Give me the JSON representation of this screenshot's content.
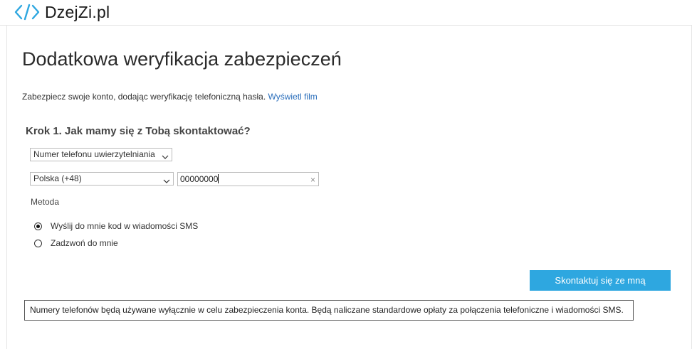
{
  "header": {
    "logo_text": "DzejZi.pl",
    "logo_icon": "code-brackets-icon",
    "accent_color": "#2ea7e0"
  },
  "main": {
    "title": "Dodatkowa weryfikacja zabezpieczeń",
    "intro_text": "Zabezpiecz swoje konto, dodając weryfikację telefoniczną hasła.",
    "intro_link": "Wyświetl film",
    "step_title": "Krok 1. Jak mamy się z Tobą skontaktować?",
    "auth_method_select": {
      "value": "Numer telefonu uwierzytelniania"
    },
    "country_select": {
      "value": "Polska (+48)"
    },
    "phone_input": {
      "value": "00000000"
    },
    "method_label": "Metoda",
    "radio_options": [
      {
        "label": "Wyślij do mnie kod w wiadomości SMS",
        "checked": true
      },
      {
        "label": "Zadzwoń do mnie",
        "checked": false
      }
    ],
    "contact_button": "Skontaktuj się ze mną",
    "notice": "Numery telefonów będą używane wyłącznie w celu zabezpieczenia konta. Będą naliczane standardowe opłaty za połączenia telefoniczne i wiadomości SMS."
  }
}
